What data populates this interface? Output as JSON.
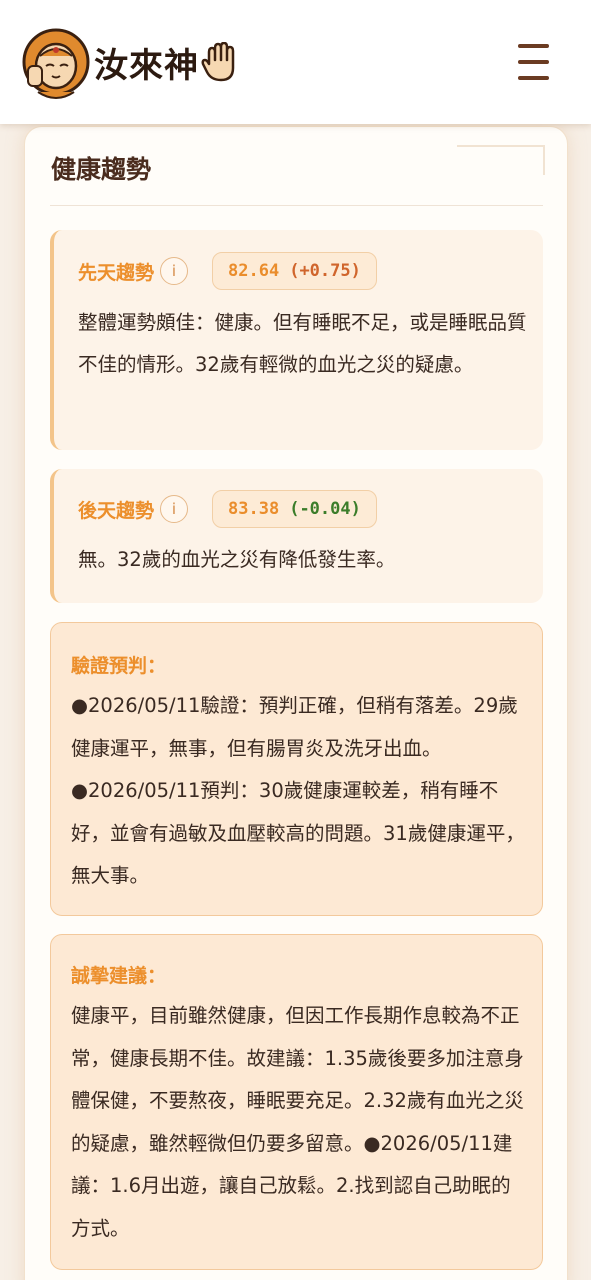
{
  "header": {
    "logo_text": "汝來神",
    "menu_icon": "hamburger-menu-icon"
  },
  "section": {
    "title": "健康趨勢"
  },
  "innate": {
    "label": "先天趨勢",
    "info": "i",
    "score": "82.64",
    "delta": "(+0.75)",
    "text": "整體運勢頗佳：健康。但有睡眠不足，或是睡眠品質不佳的情形。32歲有輕微的血光之災的疑慮。"
  },
  "acquired": {
    "label": "後天趨勢",
    "info": "i",
    "score": "83.38",
    "delta": "(-0.04)",
    "text": "無。32歲的血光之災有降低發生率。"
  },
  "verification": {
    "title": "驗證預判：",
    "text": "●2026/05/11驗證：預判正確，但稍有落差。29歲健康運平，無事，但有腸胃炎及洗牙出血。●2026/05/11預判：30歲健康運較差，稍有睡不好，並會有過敏及血壓較高的問題。31歲健康運平，無大事。"
  },
  "advice": {
    "title": "誠摯建議：",
    "text": "健康平，目前雖然健康，但因工作長期作息較為不正常，健康長期不佳。故建議：1.35歲後要多加注意身體保健，不要熬夜，睡眠要充足。2.32歲有血光之災的疑慮，雖然輕微但仍要多留意。●2026/05/11建議：1.6月出遊，讓自己放鬆。2.找到認自己助眠的方式。"
  },
  "colors": {
    "accent_orange": "#ec8f2c",
    "positive_delta": "#d0652c",
    "negative_delta": "#3c7d2a",
    "box_bg": "#fde9d4"
  }
}
